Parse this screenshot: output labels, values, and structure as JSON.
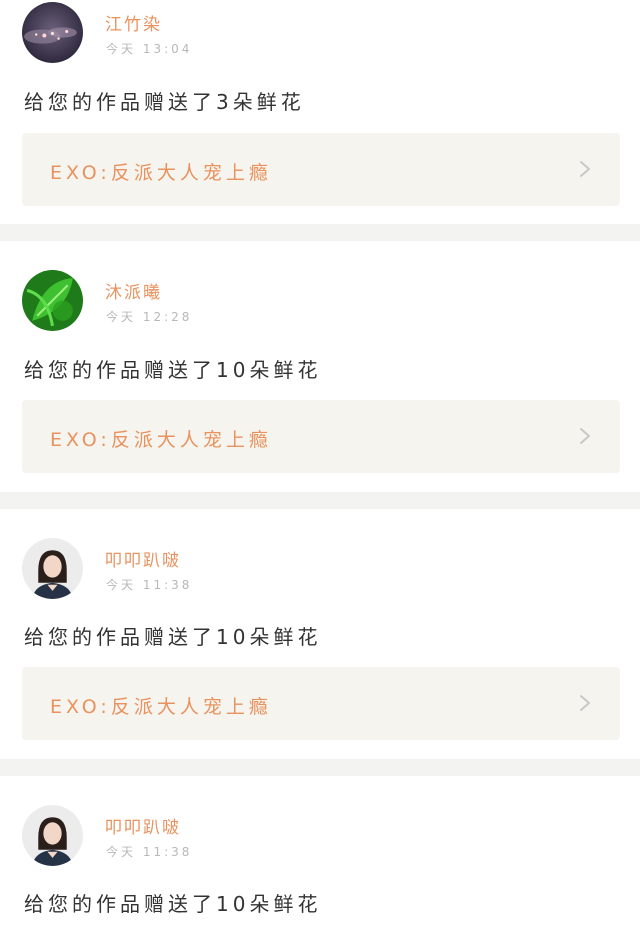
{
  "items": [
    {
      "username": "江竹染",
      "time": "今天 13:04",
      "message": "给您的作品赠送了3朵鲜花",
      "work_title": "EXO:反派大人宠上瘾",
      "avatar": "night-sky-avatar"
    },
    {
      "username": "沐派曦",
      "time": "今天 12:28",
      "message": "给您的作品赠送了10朵鲜花",
      "work_title": "EXO:反派大人宠上瘾",
      "avatar": "green-leaf-avatar"
    },
    {
      "username": "叩叩趴啵",
      "time": "今天 11:38",
      "message": "给您的作品赠送了10朵鲜花",
      "work_title": "EXO:反派大人宠上瘾",
      "avatar": "woman-portrait-avatar"
    },
    {
      "username": "叩叩趴啵",
      "time": "今天 11:38",
      "message": "给您的作品赠送了10朵鲜花",
      "work_title": "",
      "avatar": "woman-portrait-avatar"
    }
  ],
  "icons": {
    "chevron": "chevron-right-icon"
  },
  "colors": {
    "accent": "#e8935f",
    "card_bg": "#f5f4ee",
    "divider": "#f3f3f1",
    "time": "#b8b8b8"
  }
}
